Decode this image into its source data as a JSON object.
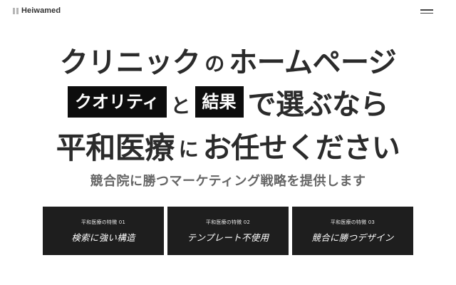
{
  "header": {
    "logo_text": "Heiwamed",
    "menu_icon": "hamburger-menu-icon"
  },
  "hero": {
    "line1": {
      "part1": "クリニック",
      "part2": "の",
      "part3": "ホームページ"
    },
    "line2": {
      "box1": "クオリティ",
      "part1": "と",
      "box2": "結果",
      "part2": "で",
      "part3": "選ぶなら"
    },
    "line3": {
      "part1": "平和医療",
      "part2": "に",
      "part3": "お任せください"
    },
    "tagline": "競合院に勝つマーケティング戦略を提供します"
  },
  "features": [
    {
      "label": "平和医療の特徴 01",
      "title": "検索に強い構造"
    },
    {
      "label": "平和医療の特徴 02",
      "title": "テンプレート不使用"
    },
    {
      "label": "平和医療の特徴 03",
      "title": "競合に勝つデザイン"
    }
  ],
  "colors": {
    "text": "#2b2b2b",
    "box_bg": "#0d0d0d",
    "card_bg": "#1e1e1e",
    "tagline": "#666666"
  }
}
